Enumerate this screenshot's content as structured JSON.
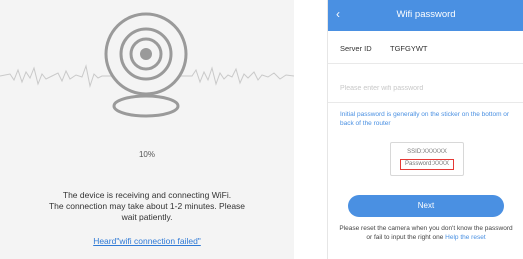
{
  "left_panel": {
    "progress_text": "10%",
    "status_lines": [
      "The device is receiving and connecting WiFi.",
      "The connection may take about 1-2 minutes. Please",
      "wait patiently."
    ],
    "help_link": "Heard\"wifi connection failed\"",
    "icons": {
      "camera": "webcam-icon",
      "wave": "sound-wave"
    }
  },
  "phone": {
    "title": "Wifi password",
    "back_icon": "chevron-left-icon",
    "ssid_label": "Server ID",
    "ssid_value": "TGFGYWT",
    "password_placeholder": "Please enter wifi password",
    "hint_text": "Initial password is generally on the sticker on the bottom or back of the router",
    "sticker": {
      "ssid_line": "SSID:XXXXXX",
      "pwd_line": "Password:XXXX"
    },
    "next_label": "Next",
    "footer_text": "Please reset the camera when you don't know the password or fail to input the right one",
    "footer_link": "Help the reset",
    "colors": {
      "accent": "#4a90e2",
      "highlight": "#e53935"
    }
  }
}
